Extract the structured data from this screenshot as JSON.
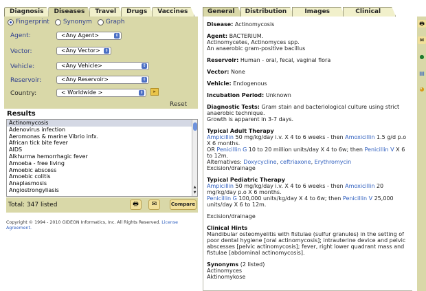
{
  "left": {
    "tabs": [
      {
        "label": "Diagnosis",
        "active": false
      },
      {
        "label": "Diseases",
        "active": true
      },
      {
        "label": "Travel",
        "active": false
      },
      {
        "label": "Drugs",
        "active": false
      },
      {
        "label": "Vaccines",
        "active": false
      }
    ],
    "radios": [
      {
        "label": "Fingerprint",
        "checked": true
      },
      {
        "label": "Synonym",
        "checked": false
      },
      {
        "label": "Graph",
        "checked": false
      }
    ],
    "filters": [
      {
        "label": "Agent:",
        "value": "<Any Agent>"
      },
      {
        "label": "Vector:",
        "value": "<Any Vector>"
      },
      {
        "label": "Vehicle:",
        "value": "<Any Vehicle>"
      },
      {
        "label": "Reservoir:",
        "value": "<Any Reservoir>"
      },
      {
        "label": "Country:",
        "value": "< Worldwide >"
      }
    ],
    "reset_label": "Reset",
    "results_title": "Results",
    "results": [
      "Actinomycosis",
      "Adenovirus infection",
      "Aeromonas & marine Vibrio infx.",
      "African tick bite fever",
      "AIDS",
      "Alkhurma hemorrhagic fever",
      "Amoeba - free living",
      "Amoebic abscess",
      "Amoebic colitis",
      "Anaplasmosis",
      "Angiostrongyliasis"
    ],
    "selected_index": 0,
    "total": "Total: 347 listed",
    "compare_label": "Compare",
    "copyright": "Copyright © 1994 - 2010 GIDEON Informatics, Inc. All Rights Reserved.",
    "license_link": "License Agreement."
  },
  "right": {
    "tabs": [
      {
        "label": "General",
        "active": true
      },
      {
        "label": "Distribution",
        "active": false
      },
      {
        "label": "Images",
        "active": false
      },
      {
        "label": "Clinical",
        "active": false
      }
    ],
    "disease_label": "Disease:",
    "disease": "Actinomycosis",
    "agent_label": "Agent:",
    "agent": "BACTERIUM.",
    "agent_line2": "Actinomycetes, Actinomyces spp.",
    "agent_line3": "An anaerobic gram-positive bacillus",
    "reservoir_label": "Reservoir:",
    "reservoir": "Human - oral, fecal, vaginal flora",
    "vector_label": "Vector:",
    "vector": "None",
    "vehicle_label": "Vehicle:",
    "vehicle": "Endogenous",
    "incubation_label": "Incubation Period:",
    "incubation": "Unknown",
    "diagnostic_label": "Diagnostic Tests:",
    "diagnostic": "Gram stain and bacteriological culture using strict anaerobic technique.",
    "diagnostic_line2": "Growth is apparent in 3-7 days.",
    "adult_title": "Typical Adult Therapy",
    "adult": {
      "l1a": "Ampicillin",
      "l1b": " 50 mg/kg/day i.v. X 4 to 6 weeks - then ",
      "l1c": "Amoxicillin",
      "l1d": " 1.5 g/d p.o X 6 months.",
      "l2a": "OR ",
      "l2b": "Penicillin G",
      "l2c": " 10 to 20 million units/day X 4 to 6w; then ",
      "l2d": "Penicillin V",
      "l2e": " X 6 to 12m.",
      "l3a": "Alternatives: ",
      "l3b": "Doxycycline",
      "l3c": ", ",
      "l3d": "ceftriaxone",
      "l3e": ", ",
      "l3f": "Erythromycin",
      "l4": "Excision/drainage"
    },
    "peds_title": "Typical Pediatric Therapy",
    "peds": {
      "l1a": "Ampicillin",
      "l1b": " 50 mg/kg/day i.v. X 4 to 6 weeks - then ",
      "l1c": "Amoxicillin",
      "l1d": " 20 mg/kg/day p.o X 6 months.",
      "l2a": "Penicillin G",
      "l2b": " 100,000 units/kg/day X 4 to 6w; then ",
      "l2c": "Penicillin V",
      "l2d": " 25,000 units/day X 6 to 12m.",
      "l3": "Excision/drainage"
    },
    "clinical_title": "Clinical Hints",
    "clinical": "Mandibular osteomyelitis with fistulae (sulfur granules) in the setting of poor dental hygiene [oral actinomycosis]; intrauterine device and pelvic abscesses [pelvic actinomycosis]; fever, right lower quadrant mass and fistulae [abdominal actinomycosis].",
    "synonyms_title": "Synonyms",
    "synonyms_count": "(2 listed)",
    "synonyms": [
      "Actinomyces",
      "Aktinomykose"
    ]
  },
  "icons": {
    "print": "printer-icon",
    "email": "envelope-icon",
    "side": [
      "printer-icon",
      "envelope-icon",
      "globe-icon",
      "chart-icon",
      "pie-icon"
    ]
  }
}
